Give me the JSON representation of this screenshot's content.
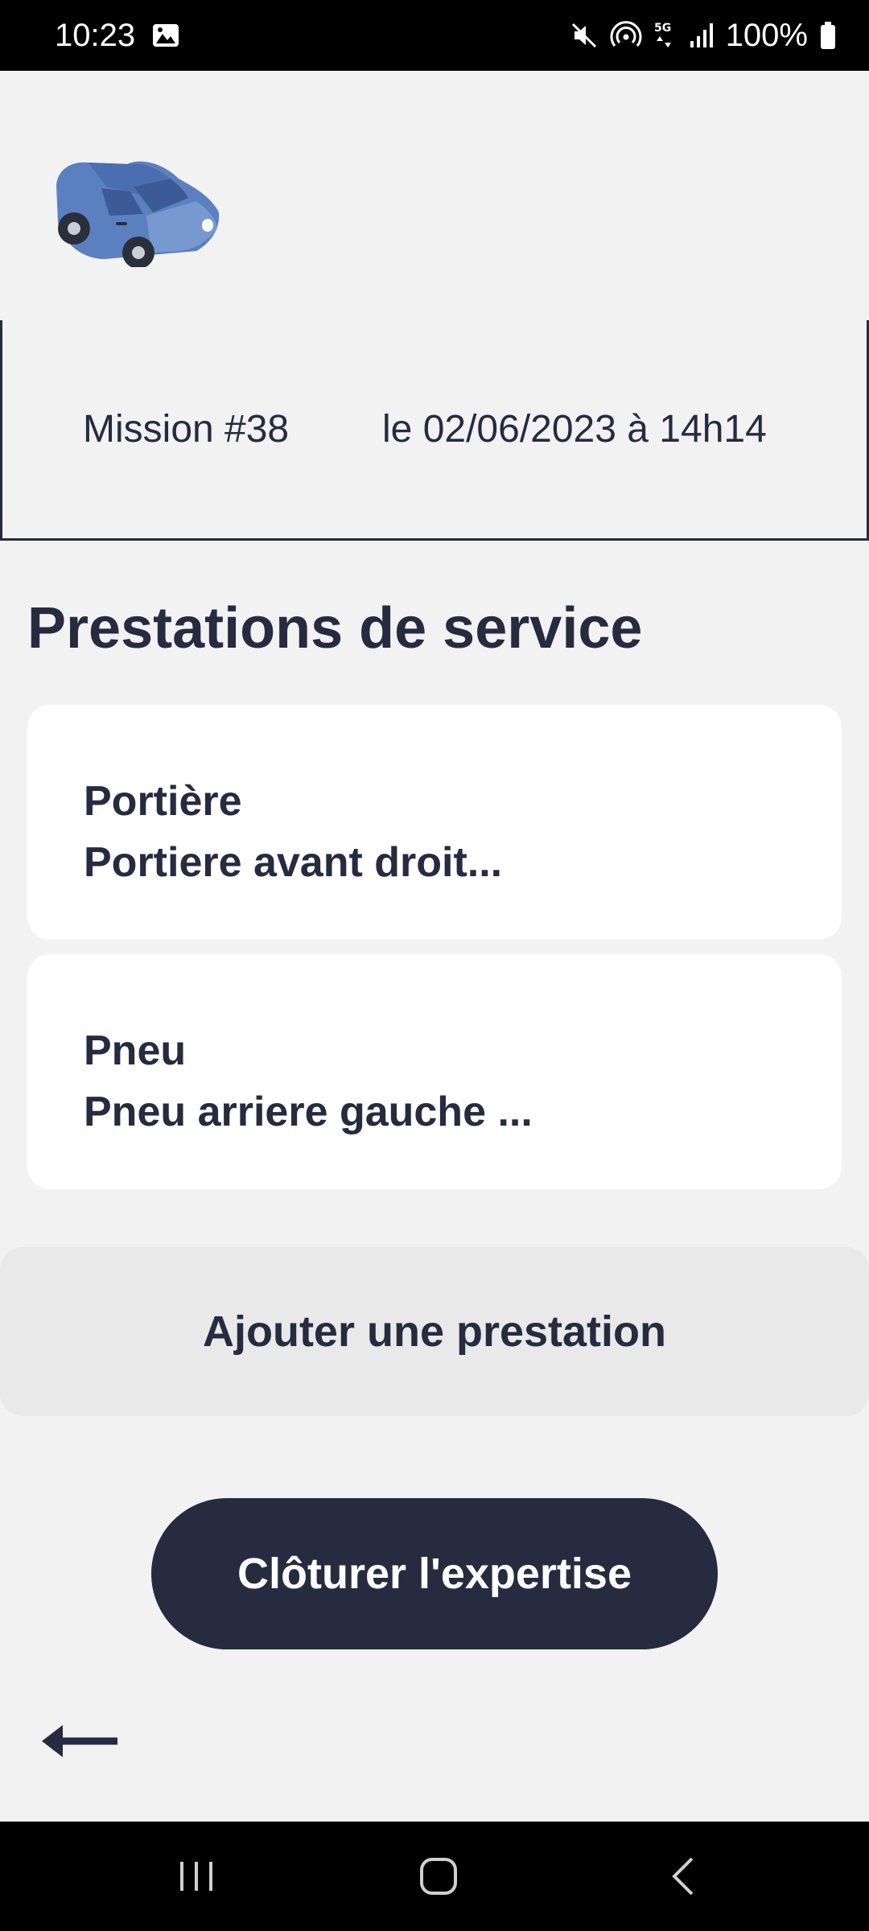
{
  "status_bar": {
    "time": "10:23",
    "battery": "100%",
    "network": "5G",
    "icons": [
      "image-icon",
      "mute-icon",
      "hotspot-icon",
      "5g-icon",
      "signal-icon",
      "battery-icon"
    ]
  },
  "header": {
    "logo_icon": "car-icon"
  },
  "mission": {
    "number": "Mission #38",
    "date": "le 02/06/2023 à 14h14"
  },
  "section": {
    "title": "Prestations de service"
  },
  "services": [
    {
      "title": "Portière",
      "description": "Portiere avant droit..."
    },
    {
      "title": "Pneu",
      "description": "Pneu arriere gauche ..."
    }
  ],
  "actions": {
    "add_label": "Ajouter une prestation",
    "close_label": "Clôturer l'expertise"
  },
  "navigation": {
    "back_icon": "back-arrow-icon",
    "system_buttons": [
      "recent-apps-icon",
      "home-icon",
      "system-back-icon"
    ]
  },
  "colors": {
    "primary": "#262b40",
    "background": "#f2f2f2",
    "card": "#ffffff",
    "secondary_button": "#e9e9e9",
    "car_blue": "#5b80c0"
  }
}
